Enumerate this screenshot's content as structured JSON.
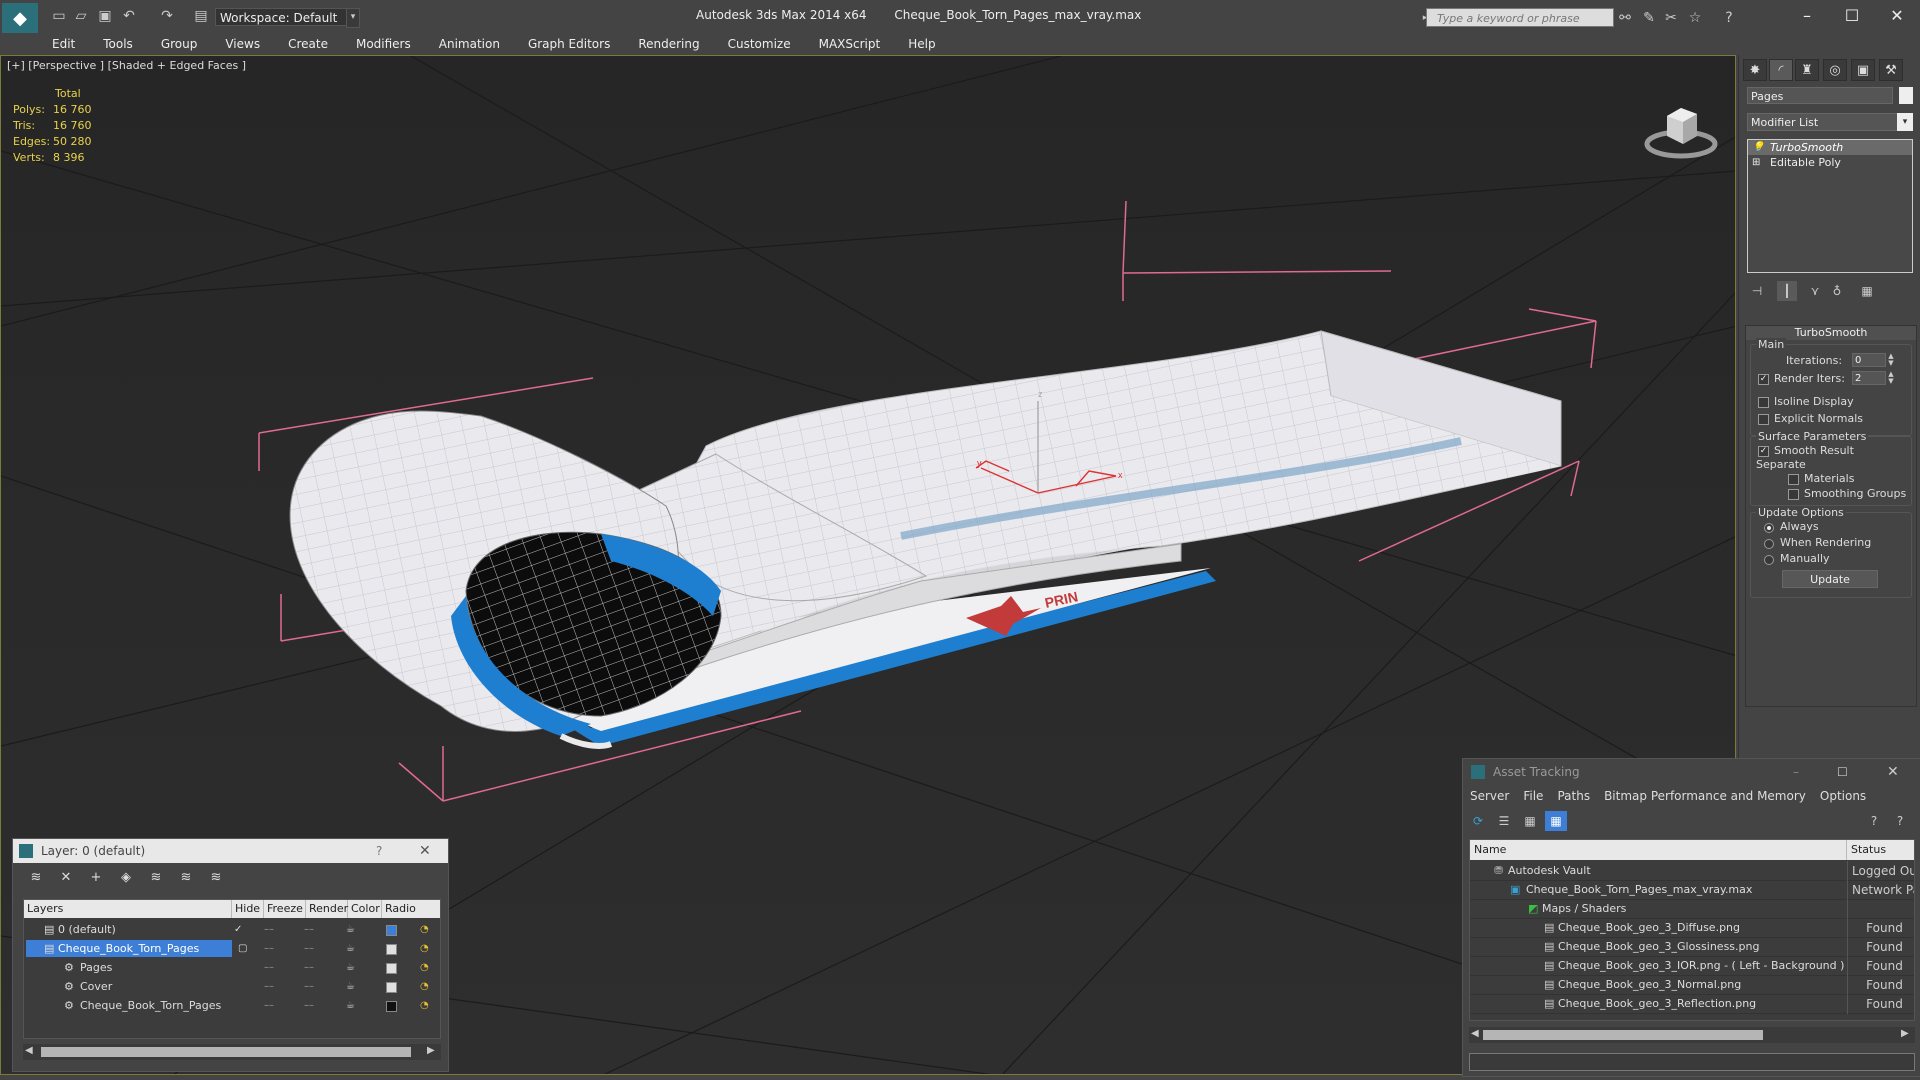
{
  "titlebar": {
    "workspace": "Workspace: Default",
    "app_name": "Autodesk 3ds Max  2014 x64",
    "file_name": "Cheque_Book_Torn_Pages_max_vray.max",
    "search_placeholder": "Type a keyword or phrase"
  },
  "menu": [
    "Edit",
    "Tools",
    "Group",
    "Views",
    "Create",
    "Modifiers",
    "Animation",
    "Graph Editors",
    "Rendering",
    "Customize",
    "MAXScript",
    "Help"
  ],
  "viewport": {
    "label": "[+] [Perspective ] [Shaded + Edged Faces ]",
    "stats": {
      "header": "Total",
      "rows": [
        {
          "k": "Polys:",
          "v": "16 760"
        },
        {
          "k": "Tris:",
          "v": "16 760"
        },
        {
          "k": "Edges:",
          "v": "50 280"
        },
        {
          "k": "Verts:",
          "v": "8 396"
        }
      ]
    },
    "gizmo": {
      "x": "x",
      "y": "y",
      "z": "z"
    }
  },
  "command_panel": {
    "object_name": "Pages",
    "modifier_list": "Modifier List",
    "stack": [
      "TurboSmooth",
      "Editable Poly"
    ],
    "rollout_title": "TurboSmooth",
    "main_label": "Main",
    "iterations_label": "Iterations:",
    "iterations_value": "0",
    "render_iters_label": "Render Iters:",
    "render_iters_value": "2",
    "isoline_label": "Isoline Display",
    "explicit_normals_label": "Explicit Normals",
    "surface_params_label": "Surface Parameters",
    "smooth_result_label": "Smooth Result",
    "separate_label": "Separate",
    "materials_label": "Materials",
    "smoothing_groups_label": "Smoothing Groups",
    "update_options_label": "Update Options",
    "always_label": "Always",
    "when_rendering_label": "When Rendering",
    "manually_label": "Manually",
    "update_button": "Update"
  },
  "layer_dialog": {
    "title": "Layer: 0 (default)",
    "help": "?",
    "columns": [
      "Layers",
      "Hide",
      "Freeze",
      "Render",
      "Color",
      "Radio"
    ],
    "rows": [
      {
        "name": "0 (default)",
        "color": "#3d7fd6"
      },
      {
        "name": "Cheque_Book_Torn_Pages",
        "color": "#e0e0e0"
      },
      {
        "name": "Pages",
        "color": "#e0e0e0"
      },
      {
        "name": "Cover",
        "color": "#e0e0e0"
      },
      {
        "name": "Cheque_Book_Torn_Pages",
        "color": "#111111"
      }
    ]
  },
  "asset_dialog": {
    "title": "Asset Tracking",
    "menu": [
      "Server",
      "File",
      "Paths",
      "Bitmap Performance and Memory",
      "Options"
    ],
    "columns": [
      "Name",
      "Status"
    ],
    "rows": [
      {
        "name": "Autodesk Vault",
        "status": "Logged Out"
      },
      {
        "name": "Cheque_Book_Torn_Pages_max_vray.max",
        "status": "Network Path"
      },
      {
        "name": "Maps / Shaders",
        "status": ""
      },
      {
        "name": "Cheque_Book_geo_3_Diffuse.png",
        "status": "Found"
      },
      {
        "name": "Cheque_Book_geo_3_Glossiness.png",
        "status": "Found"
      },
      {
        "name": "Cheque_Book_geo_3_IOR.png -  ( Left - Background )",
        "status": "Found"
      },
      {
        "name": "Cheque_Book_geo_3_Normal.png",
        "status": "Found"
      },
      {
        "name": "Cheque_Book_geo_3_Reflection.png",
        "status": "Found"
      }
    ]
  },
  "colors": {
    "viewport_bg": "#2c2c2c",
    "stats_yellow": "#e8d24a",
    "selection_blue": "#3d7fd6",
    "bbox_pink": "#e06a90",
    "page_blue": "#1e7fd0"
  }
}
